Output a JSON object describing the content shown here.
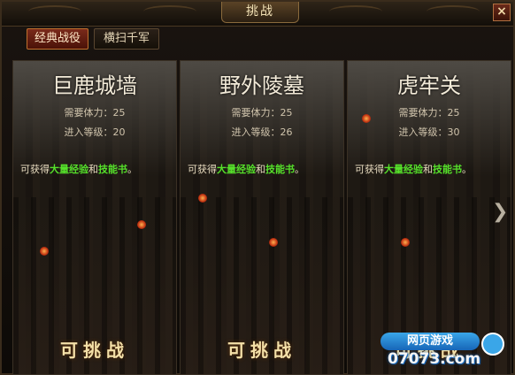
{
  "window": {
    "title": "挑战",
    "close_label": "×"
  },
  "tabs": [
    {
      "label": "经典战役",
      "active": true
    },
    {
      "label": "横扫千军",
      "active": false
    }
  ],
  "cards": [
    {
      "name": "巨鹿城墙",
      "stamina": "需要体力：25",
      "level": "进入等级：20",
      "reward_prefix": "可获得",
      "reward_a": "大量经验",
      "reward_mid": "和",
      "reward_b": "技能书",
      "reward_suffix": "。",
      "action": "可挑战"
    },
    {
      "name": "野外陵墓",
      "stamina": "需要体力：25",
      "level": "进入等级：26",
      "reward_prefix": "可获得",
      "reward_a": "大量经验",
      "reward_mid": "和",
      "reward_b": "技能书",
      "reward_suffix": "。",
      "action": "可挑战"
    },
    {
      "name": "虎牢关",
      "stamina": "需要体力：25",
      "level": "进入等级：30",
      "reward_prefix": "可获得",
      "reward_a": "大量经验",
      "reward_mid": "和",
      "reward_b": "技能书",
      "reward_suffix": "。",
      "action": "可挑战"
    }
  ],
  "next_arrow": "❯",
  "watermark": {
    "top": "网页游戏",
    "bottom": "07073.com"
  },
  "colors": {
    "highlight_green": "#55e02a",
    "active_tab": "#7a2a1a",
    "title_gold": "#f3e2b6"
  }
}
